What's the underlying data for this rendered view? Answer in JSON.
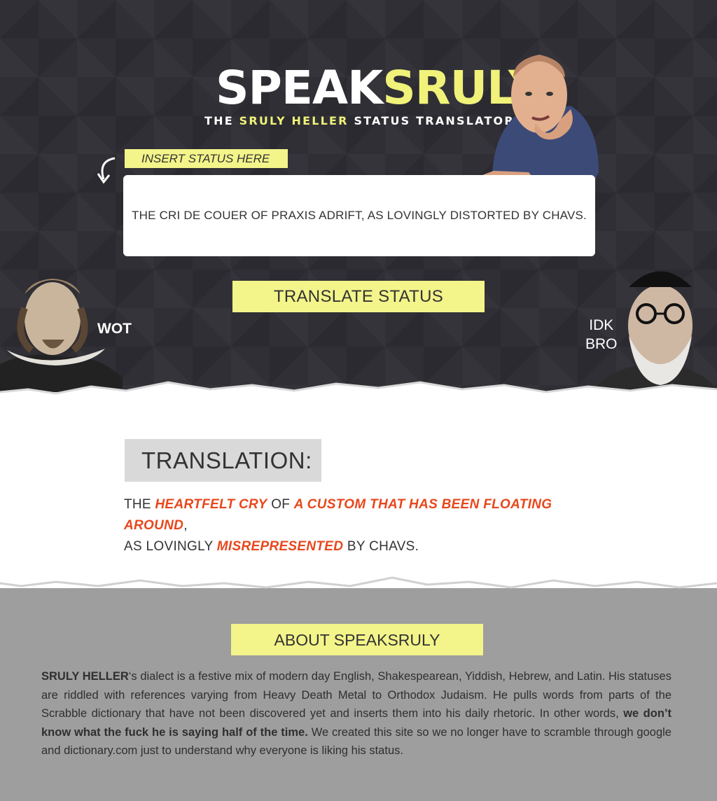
{
  "header": {
    "logo_part1": "SPEAK",
    "logo_part2": "SRULY",
    "tagline_pre": "THE ",
    "tagline_name": "SRULY HELLER",
    "tagline_post": " STATUS TRANSLATOR"
  },
  "input": {
    "label": "INSERT STATUS HERE",
    "value": "THE CRI DE COUER OF PRAXIS ADRIFT, AS LOVINGLY DISTORTED BY CHAVS."
  },
  "translate_button": "TRANSLATE STATUS",
  "captions": {
    "left": "WOT",
    "right_line1": "IDK",
    "right_line2": "BRO"
  },
  "translation": {
    "heading": "TRANSLATION:",
    "parts": [
      "THE ",
      "HEARTFELT CRY",
      " OF ",
      "A CUSTOM THAT HAS BEEN FLOATING AROUND",
      ","
    ],
    "line2_parts": [
      "AS LOVINGLY ",
      "MISREPRESENTED",
      " BY CHAVS."
    ]
  },
  "about": {
    "button": "ABOUT SPEAKSRULY",
    "name": "SRULY HELLER",
    "text1": "‘s dialect is a festive mix of modern day English, Shakespearean, Yiddish, Hebrew, and Latin. His statuses are riddled with references varying from Heavy Death Metal to Orthodox Judaism. He pulls words from parts of the Scrabble dictionary that have not been discovered yet and inserts them into his daily rhetoric. In other words, ",
    "bold": "we don’t know what the fuck he is saying half of the time.",
    "text2": " We created this site so we no longer have to scramble through google and dictionary.com just to understand why everyone is liking his status."
  },
  "colors": {
    "dark_bg": "#302f35",
    "accent_yellow": "#f3f48a",
    "highlight_orange": "#e8471c",
    "grey_bg": "#9e9e9e"
  }
}
